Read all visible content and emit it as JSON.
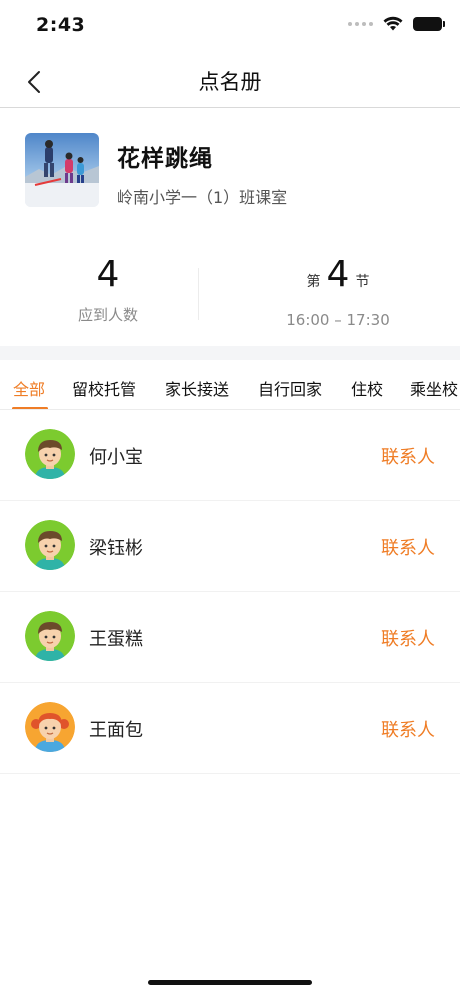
{
  "status_bar": {
    "time": "2:43"
  },
  "nav": {
    "title": "点名册"
  },
  "course": {
    "name": "花样跳绳",
    "location": "岭南小学一（1）班课室"
  },
  "stats": {
    "expected_count": "4",
    "expected_label": "应到人数",
    "lesson_prefix": "第",
    "lesson_number": "4",
    "lesson_suffix": "节",
    "lesson_time": "16:00 – 17:30"
  },
  "tabs": [
    {
      "label": "全部",
      "active": true
    },
    {
      "label": "留校托管",
      "active": false
    },
    {
      "label": "家长接送",
      "active": false
    },
    {
      "label": "自行回家",
      "active": false
    },
    {
      "label": "住校",
      "active": false
    },
    {
      "label": "乘坐校",
      "active": false
    }
  ],
  "students": [
    {
      "name": "何小宝",
      "contact_label": "联系人",
      "avatar": "boy-avatar-icon"
    },
    {
      "name": "梁钰彬",
      "contact_label": "联系人",
      "avatar": "boy-avatar-icon"
    },
    {
      "name": "王蛋糕",
      "contact_label": "联系人",
      "avatar": "boy-avatar-icon"
    },
    {
      "name": "王面包",
      "contact_label": "联系人",
      "avatar": "girl-avatar-icon"
    }
  ],
  "colors": {
    "accent": "#ef7d26",
    "avatar_green": "#7ccb2f",
    "avatar_orange": "#f7a531"
  }
}
